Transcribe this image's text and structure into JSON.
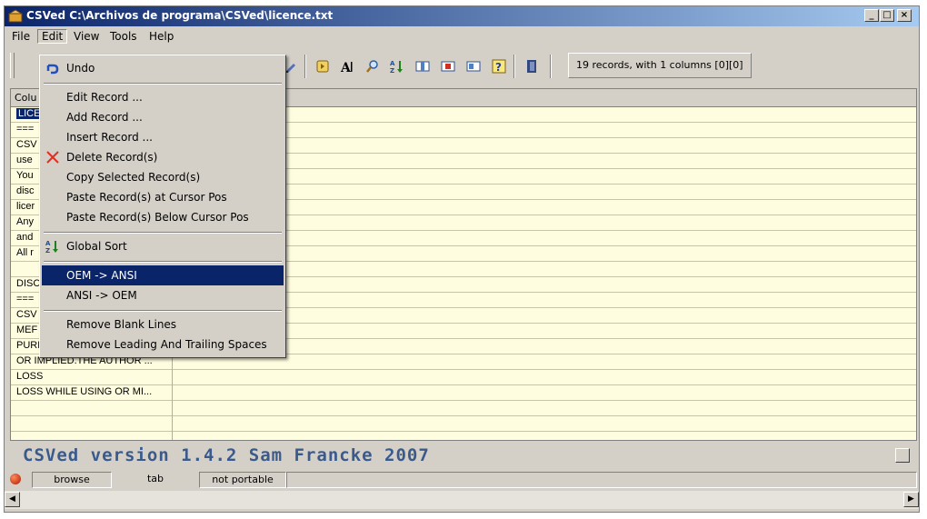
{
  "window": {
    "title": "CSVed C:\\Archivos de programa\\CSVed\\licence.txt"
  },
  "menubar": {
    "items": [
      "File",
      "Edit",
      "View",
      "Tools",
      "Help"
    ]
  },
  "toolbar": {
    "status": "19 records, with 1 columns [0][0]"
  },
  "edit_menu": {
    "undo": "Undo",
    "edit_record": "Edit Record ...",
    "add_record": "Add Record ...",
    "insert_record": "Insert Record ...",
    "delete_records": "Delete Record(s)",
    "copy_selected": "Copy Selected Record(s)",
    "paste_at_cursor": "Paste Record(s) at Cursor Pos",
    "paste_below_cursor": "Paste Record(s) Below Cursor Pos",
    "global_sort": "Global Sort",
    "oem_to_ansi": "OEM -> ANSI",
    "ansi_to_oem": "ANSI -> OEM",
    "remove_blank_lines": "Remove Blank Lines",
    "remove_spaces": "Remove Leading And Trailing Spaces"
  },
  "grid": {
    "header": "Colu",
    "rows": [
      "LICE",
      "===",
      "CSV",
      "use",
      "You",
      "disc",
      "licer",
      "Any",
      "and",
      "All r",
      "",
      "DISC",
      "===",
      "CSV",
      "MEF",
      "PURPOSE OR ANY OTHER ...",
      "OR IMPLIED.THE AUTHOR ...",
      "LOSS",
      "LOSS WHILE USING OR MI..."
    ],
    "selected_row": 0
  },
  "banner": {
    "text": "CSVed version 1.4.2 Sam Francke 2007"
  },
  "statusbar": {
    "mode": "browse",
    "separator": "tab",
    "portability": "not portable"
  },
  "colors": {
    "titlebar": "#0a246a",
    "grid_bg": "#fffde0",
    "highlight": "#0a246a",
    "banner_text": "#3a5a8c"
  }
}
